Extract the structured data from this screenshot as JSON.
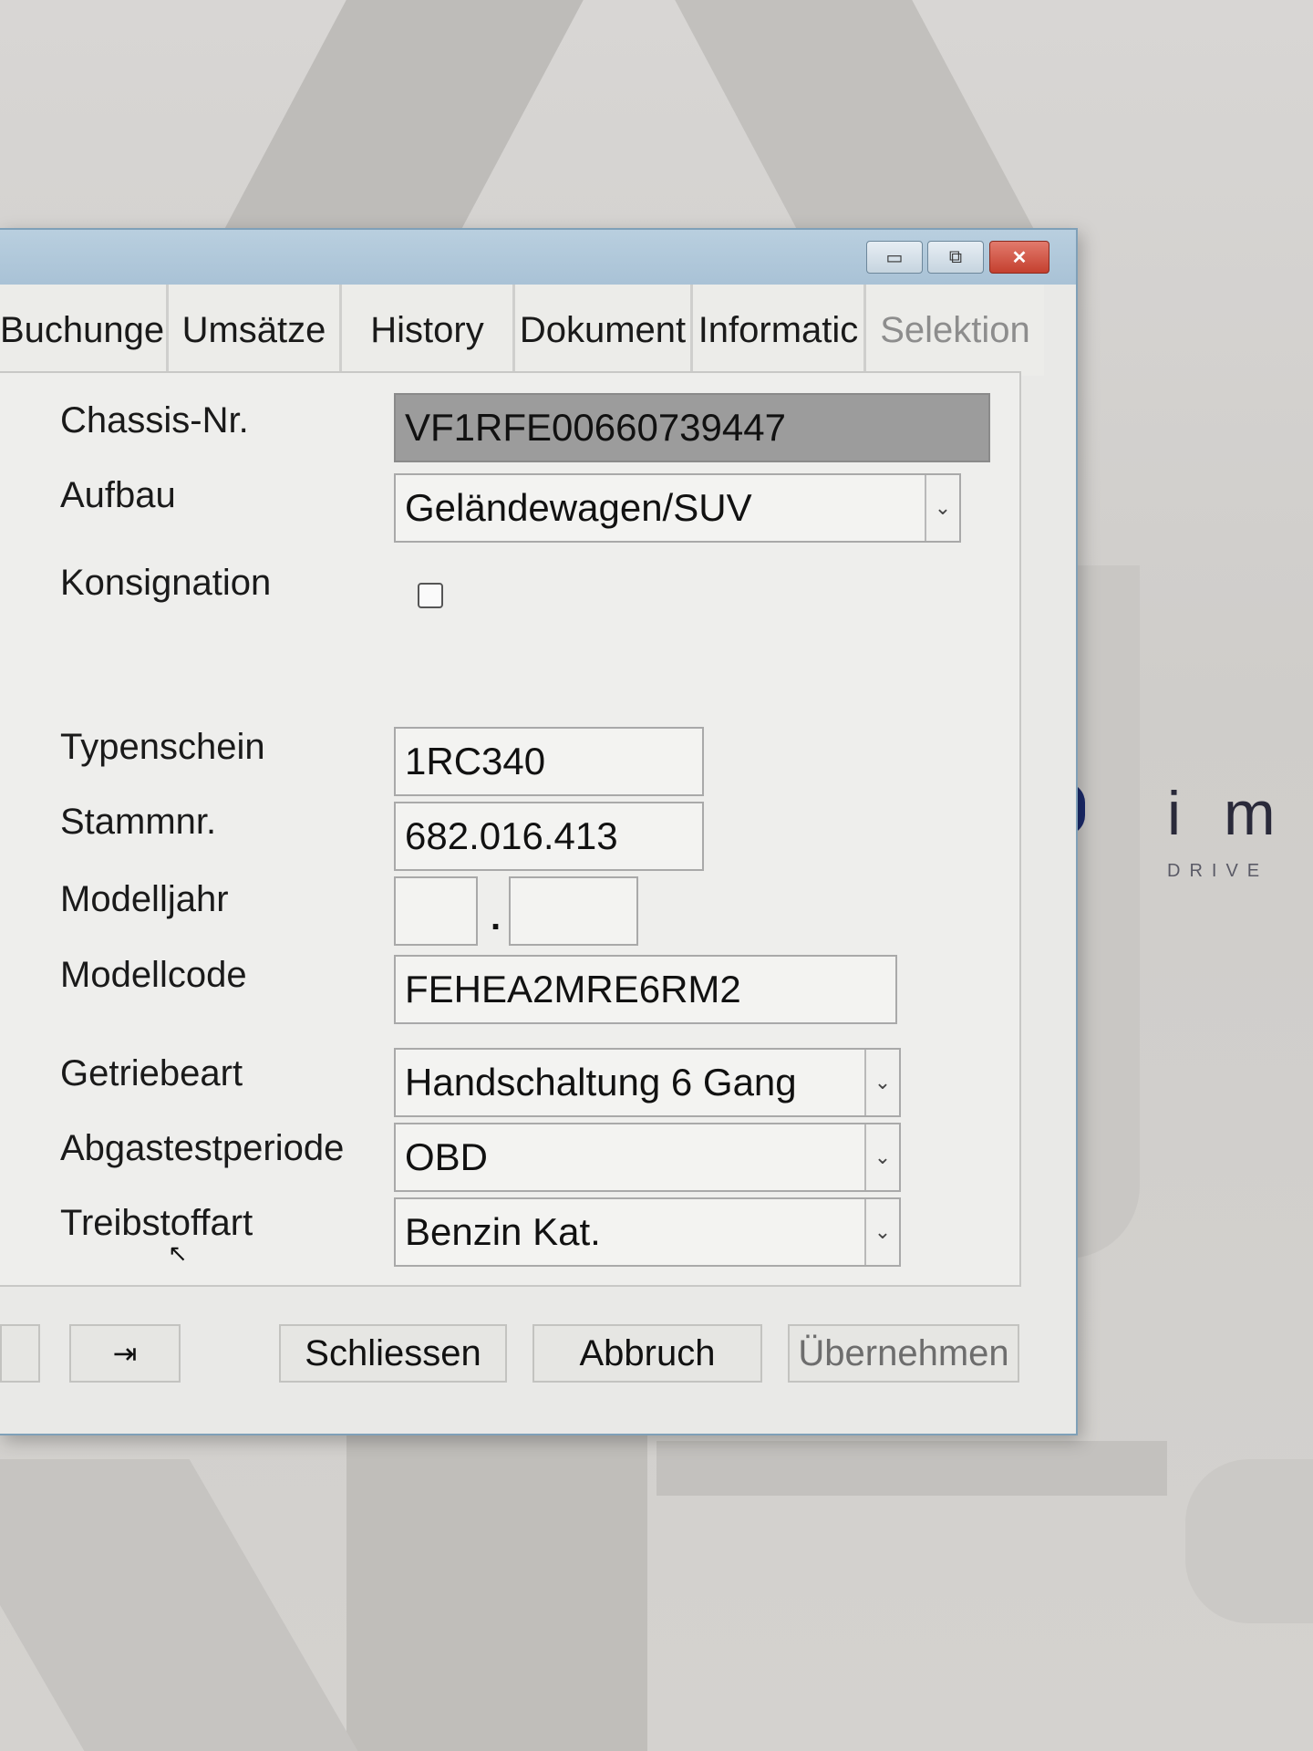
{
  "brand": {
    "name": "i m",
    "subtitle": "DRIVE"
  },
  "window": {
    "controls": {
      "minimize": "▭",
      "maximize": "⧉",
      "close": "✕"
    },
    "tabs": [
      {
        "label": "Buchunge"
      },
      {
        "label": "Umsätze"
      },
      {
        "label": "History"
      },
      {
        "label": "Dokument"
      },
      {
        "label": "Informatic"
      },
      {
        "label": "Selektion",
        "disabled": true
      }
    ]
  },
  "form": {
    "chassis": {
      "label": "Chassis-Nr.",
      "value": "VF1RFE00660739447"
    },
    "aufbau": {
      "label": "Aufbau",
      "value": "Geländewagen/SUV"
    },
    "konsignation": {
      "label": "Konsignation",
      "checked": false
    },
    "typenschein": {
      "label": "Typenschein",
      "value": "1RC340"
    },
    "stammnr": {
      "label": "Stammnr.",
      "value": "682.016.413"
    },
    "modelljahr": {
      "label": "Modelljahr",
      "value1": "",
      "separator": ".",
      "value2": ""
    },
    "modellcode": {
      "label": "Modellcode",
      "value": "FEHEA2MRE6RM2"
    },
    "getriebeart": {
      "label": "Getriebeart",
      "value": "Handschaltung 6 Gang"
    },
    "abgastestperiode": {
      "label": "Abgastestperiode",
      "value": "OBD"
    },
    "treibstoffart": {
      "label": "Treibstoffart",
      "value": "Benzin Kat."
    }
  },
  "buttons": {
    "pin": "⇥",
    "schliessen": "Schliessen",
    "abbruch": "Abbruch",
    "uebernehmen": "Übernehmen"
  },
  "dropdown_icon": "⌄"
}
